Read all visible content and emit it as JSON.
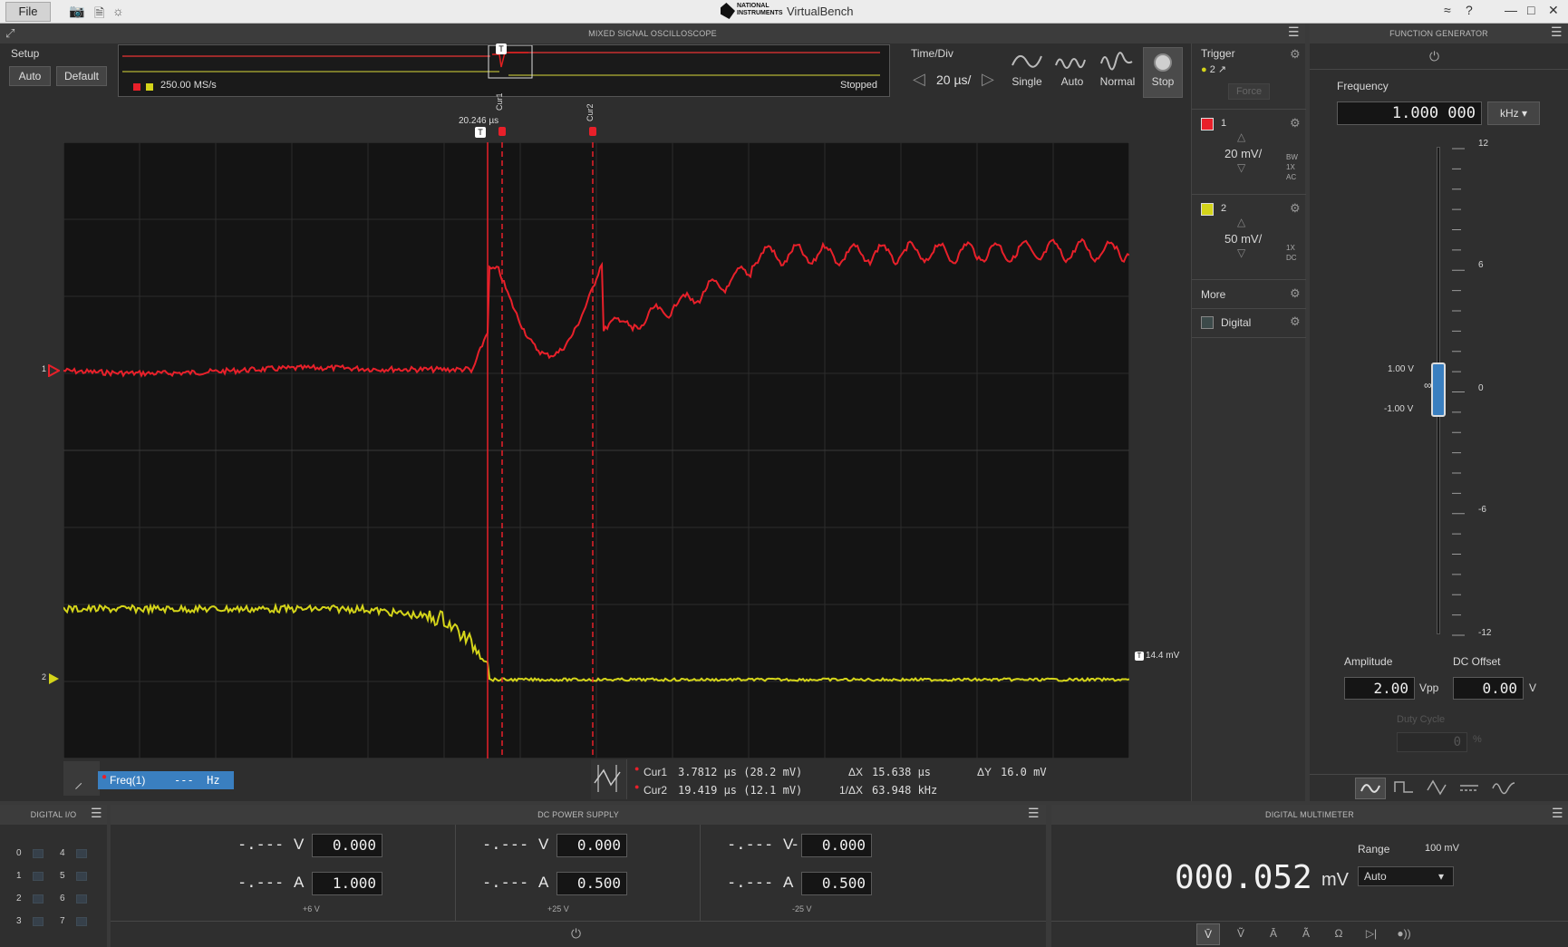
{
  "window": {
    "file_label": "File",
    "app_title": "VirtualBench",
    "logo_text": "NATIONAL INSTRUMENTS"
  },
  "scope": {
    "panel_title": "MIXED SIGNAL OSCILLOSCOPE",
    "setup_label": "Setup",
    "auto_label": "Auto",
    "default_label": "Default",
    "sample_rate": "250.00 MS/s",
    "status": "Stopped",
    "time_div_label": "Time/Div",
    "time_div_value": "20 µs/",
    "modes": [
      "Single",
      "Auto",
      "Normal",
      "Stop"
    ],
    "trigger_time": "20.246 µs",
    "cursor1_tag": "Cur1",
    "cursor2_tag": "Cur2",
    "trigger_level": "14.4 mV",
    "ch1_marker": "1",
    "ch2_marker": "2",
    "freq_label": "Freq(1)",
    "freq_value": "---  Hz",
    "cur1_label": "Cur1",
    "cur1_value": "3.7812 µs (28.2 mV)",
    "cur2_label": "Cur2",
    "cur2_value": "19.419 µs (12.1 mV)",
    "dx_label": "ΔX",
    "dx_value": "15.638 µs",
    "inv_dx_label": "1/ΔX",
    "inv_dx_value": "63.948 kHz",
    "dy_label": "ΔY",
    "dy_value": "16.0 mV"
  },
  "side": {
    "trigger_label": "Trigger",
    "trigger_source": "2",
    "force_label": "Force",
    "ch1_label": "1",
    "ch1_scale": "20 mV/",
    "ch1_flags": [
      "BW",
      "1X",
      "AC"
    ],
    "ch2_label": "2",
    "ch2_scale": "50 mV/",
    "ch2_flags": [
      "1X",
      "DC"
    ],
    "more_label": "More",
    "digital_label": "Digital"
  },
  "fgen": {
    "panel_title": "FUNCTION GENERATOR",
    "frequency_label": "Frequency",
    "frequency_value": "1.000 000",
    "frequency_unit": "kHz",
    "scale_ticks": [
      "12",
      "6",
      "0",
      "-6",
      "-12"
    ],
    "high_level": "1.00 V",
    "low_level": "-1.00 V",
    "amplitude_label": "Amplitude",
    "amplitude_value": "2.00",
    "amplitude_unit": "Vpp",
    "offset_label": "DC Offset",
    "offset_value": "0.00",
    "offset_unit": "V",
    "duty_label": "Duty Cycle",
    "duty_value": "0",
    "duty_unit": "%"
  },
  "dio": {
    "panel_title": "DIGITAL I/O",
    "pins": [
      "0",
      "1",
      "2",
      "3",
      "4",
      "5",
      "6",
      "7"
    ]
  },
  "psu": {
    "panel_title": "DC POWER SUPPLY",
    "channels": [
      {
        "v_read": "-.---",
        "v_unit": "V",
        "v_set": "0.000",
        "a_read": "-.---",
        "a_unit": "A",
        "a_set": "1.000",
        "rail": "+6 V"
      },
      {
        "v_read": "-.---",
        "v_unit": "V",
        "v_set": "0.000",
        "a_read": "-.---",
        "a_unit": "A",
        "a_set": "0.500",
        "rail": "+25 V"
      },
      {
        "v_read": "-.---",
        "v_unit": "V-",
        "v_set": "0.000",
        "a_read": "-.---",
        "a_unit": "A",
        "a_set": "0.500",
        "rail": "-25 V"
      }
    ]
  },
  "dmm": {
    "panel_title": "DIGITAL MULTIMETER",
    "reading": "000.052",
    "unit": "mV",
    "range_label": "Range",
    "range_value": "100 mV",
    "range_mode": "Auto"
  },
  "colors": {
    "ch1": "#e8202a",
    "ch2": "#d4d41a",
    "accent": "#3a7fc0"
  }
}
